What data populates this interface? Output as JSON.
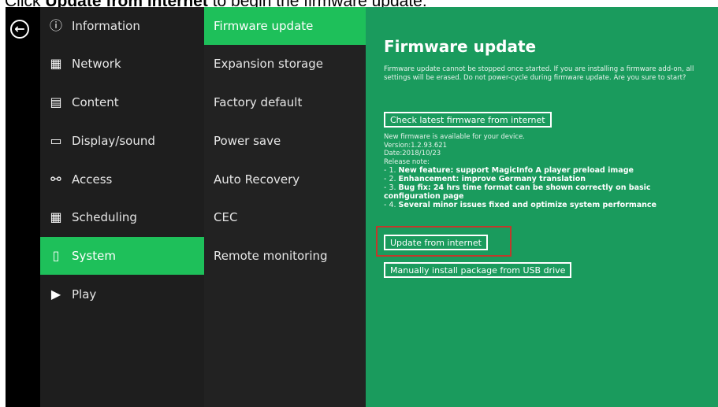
{
  "caption": {
    "prefix": "Click ",
    "bold": "Update from internet",
    "suffix": " to begin the firmware update."
  },
  "back_icon": "arrow-left-circle-icon",
  "menu": [
    {
      "label": "Information",
      "icon": "info-icon"
    },
    {
      "label": "Network",
      "icon": "network-icon"
    },
    {
      "label": "Content",
      "icon": "clapperboard-icon"
    },
    {
      "label": "Display/sound",
      "icon": "monitor-icon"
    },
    {
      "label": "Access",
      "icon": "key-icon"
    },
    {
      "label": "Scheduling",
      "icon": "calendar-icon"
    },
    {
      "label": "System",
      "icon": "system-icon",
      "active": true
    },
    {
      "label": "Play",
      "icon": "play-icon"
    }
  ],
  "submenu": [
    {
      "label": "Firmware update",
      "active": true
    },
    {
      "label": "Expansion storage"
    },
    {
      "label": "Factory default"
    },
    {
      "label": "Power save"
    },
    {
      "label": "Auto Recovery"
    },
    {
      "label": "CEC"
    },
    {
      "label": "Remote monitoring"
    }
  ],
  "panel": {
    "title": "Firmware update",
    "warning": "Firmware update cannot be stopped once started. If you are installing a firmware add-on, all settings will be erased. Do not power-cycle during firmware update. Are you sure to start?",
    "check_button": "Check latest firmware from internet",
    "available": "New firmware is available for your device.",
    "version": "Version:1.2.93.621",
    "date": "Date:2018/10/23",
    "release_note": "Release note:",
    "notes": [
      {
        "prefix": "- 1. ",
        "bold": "New feature: support MagicInfo A player preload image",
        "rest": ""
      },
      {
        "prefix": "- 2. ",
        "bold": "Enhancement: improve Germany translation",
        "rest": ""
      },
      {
        "prefix": "- 3. ",
        "bold": "Bug fix: 24 hrs time format can be shown correctly on basic configuration page",
        "rest": ""
      },
      {
        "prefix": "- 4. ",
        "bold": "Several minor issues fixed and optimize system performance",
        "rest": ""
      }
    ],
    "update_button": "Update from internet",
    "usb_button": "Manually install package from USB drive"
  },
  "colors": {
    "accent": "#1ec05a",
    "panel": "#1a9b5d",
    "highlight": "#c0392b"
  }
}
